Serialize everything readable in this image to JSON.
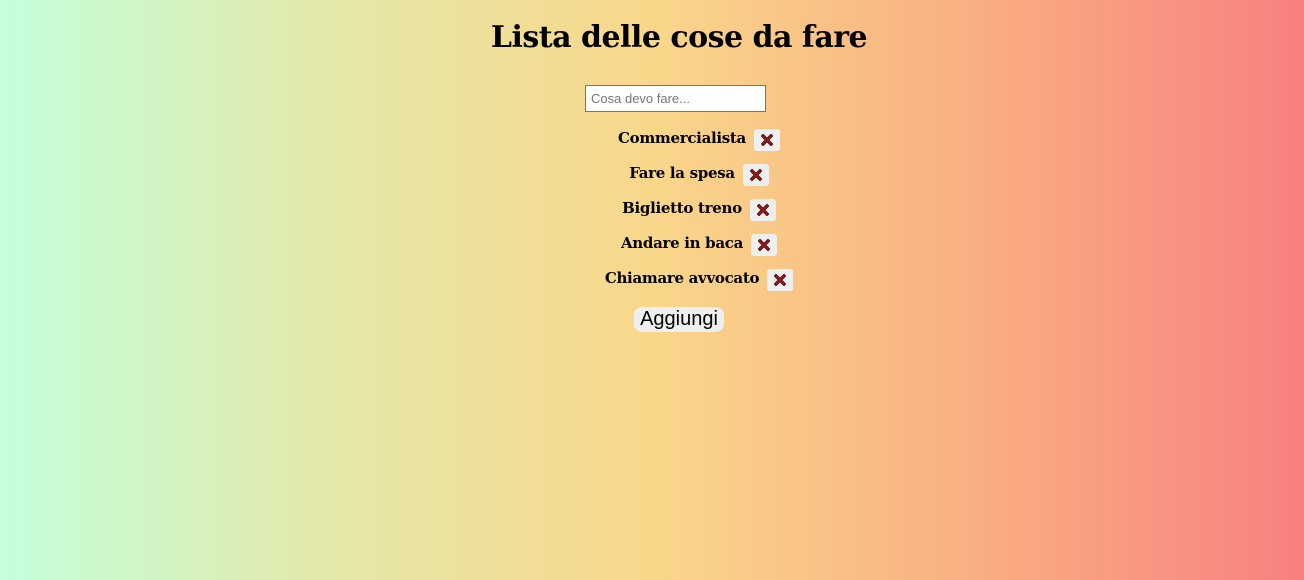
{
  "page": {
    "title": "Lista delle cose da fare"
  },
  "input": {
    "placeholder": "Cosa devo fare...",
    "value": ""
  },
  "todos": [
    {
      "label": "Commercialista",
      "delete_icon": "close-x-icon"
    },
    {
      "label": "Fare la spesa",
      "delete_icon": "close-x-icon"
    },
    {
      "label": "Biglietto treno",
      "delete_icon": "close-x-icon"
    },
    {
      "label": "Andare in baca",
      "delete_icon": "close-x-icon"
    },
    {
      "label": "Chiamare avvocato",
      "delete_icon": "close-x-icon"
    }
  ],
  "actions": {
    "add_label": "Aggiungi"
  },
  "colors": {
    "gradient_start": "#c3ffdb",
    "gradient_middle": "#f9d78a",
    "gradient_end": "#f88080",
    "delete_icon_fill": "#8b1a1a"
  }
}
